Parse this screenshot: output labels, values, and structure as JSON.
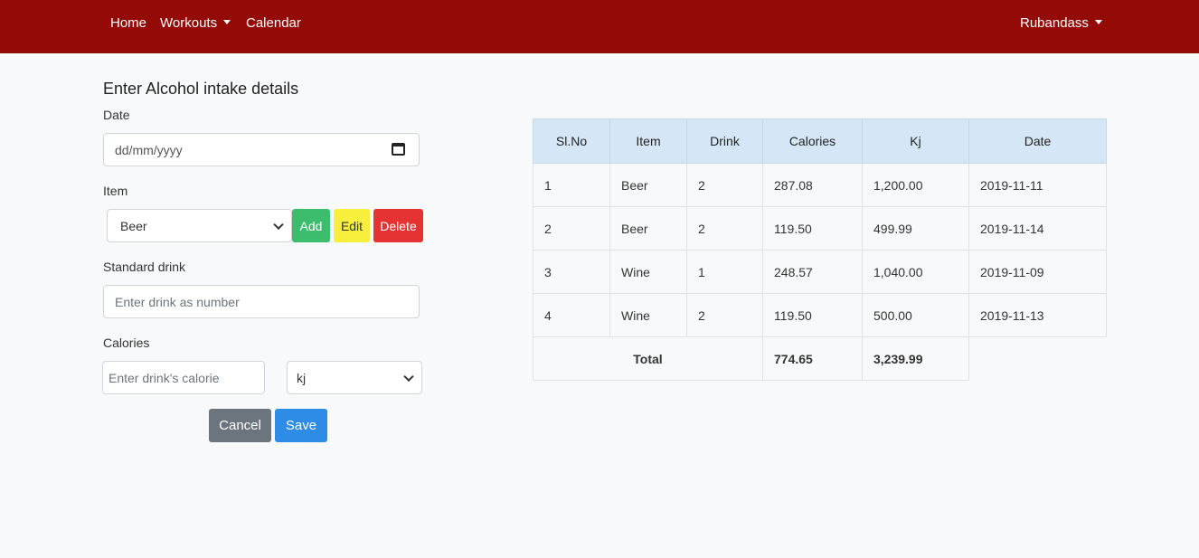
{
  "nav": {
    "home": "Home",
    "workouts": "Workouts",
    "calendar": "Calendar",
    "user": "Rubandass"
  },
  "form": {
    "title": "Enter Alcohol intake details",
    "date_label": "Date",
    "date_placeholder": "dd/mm/yyyy",
    "item_label": "Item",
    "item_selected": "Beer",
    "add": "Add",
    "edit": "Edit",
    "delete": "Delete",
    "drink_label": "Standard drink",
    "drink_placeholder": "Enter drink as number",
    "calories_label": "Calories",
    "calorie_placeholder": "Enter drink's calorie",
    "unit_selected": "kj",
    "cancel": "Cancel",
    "save": "Save"
  },
  "table": {
    "headers": [
      "Sl.No",
      "Item",
      "Drink",
      "Calories",
      "Kj",
      "Date"
    ],
    "rows": [
      [
        "1",
        "Beer",
        "2",
        "287.08",
        "1,200.00",
        "2019-11-11"
      ],
      [
        "2",
        "Beer",
        "2",
        "119.50",
        "499.99",
        "2019-11-14"
      ],
      [
        "3",
        "Wine",
        "1",
        "248.57",
        "1,040.00",
        "2019-11-09"
      ],
      [
        "4",
        "Wine",
        "2",
        "119.50",
        "500.00",
        "2019-11-13"
      ]
    ],
    "total_label": "Total",
    "total_calories": "774.65",
    "total_kj": "3,239.99"
  }
}
